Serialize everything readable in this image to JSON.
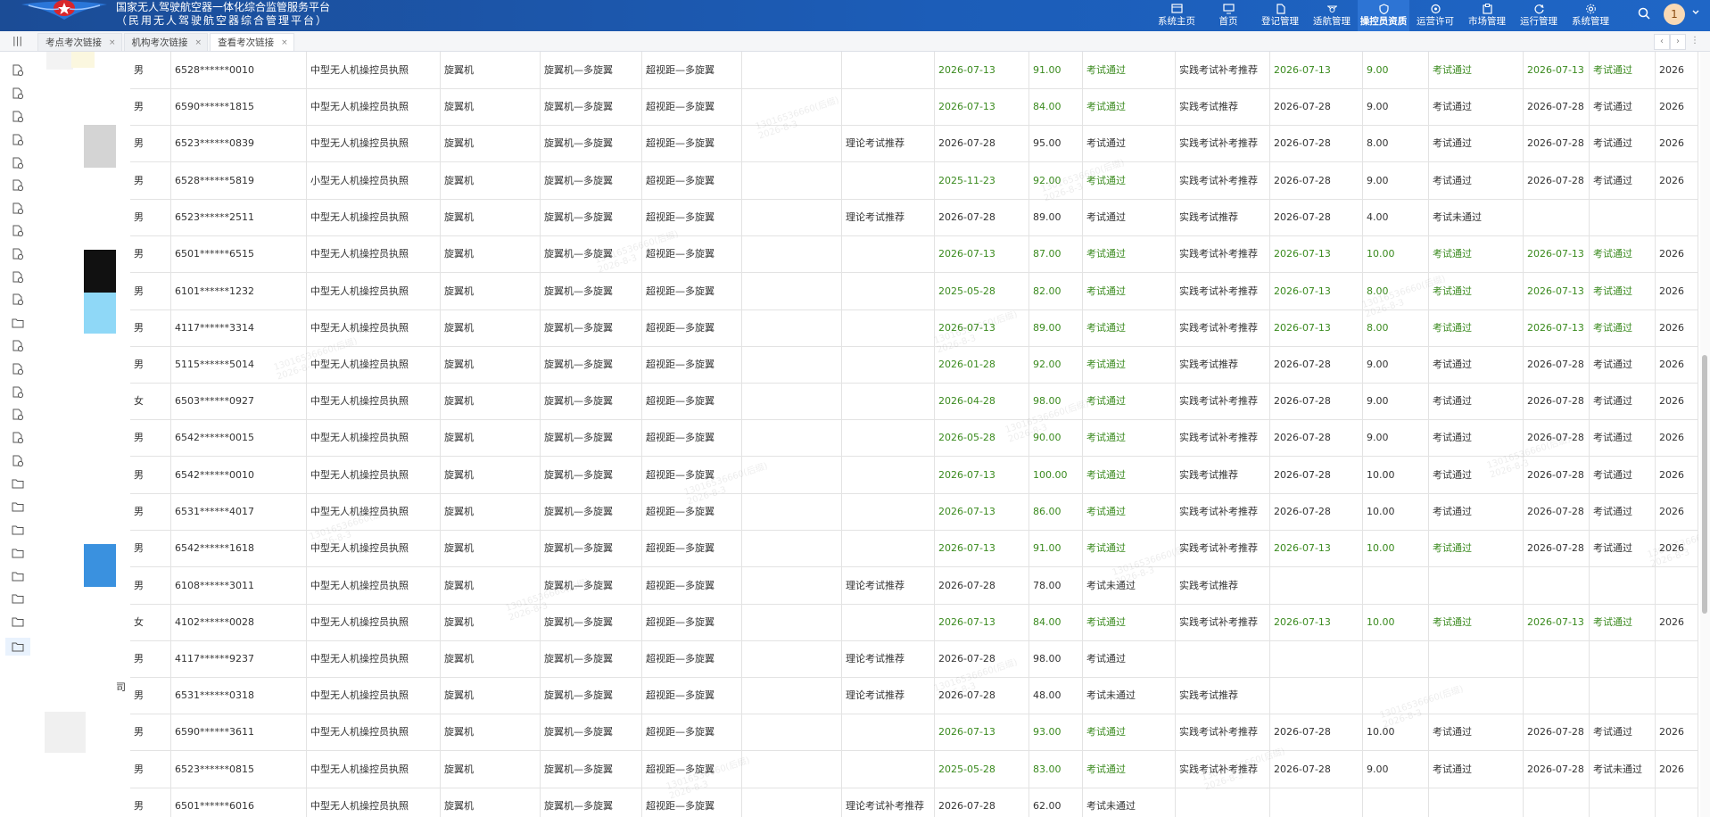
{
  "header": {
    "title_line1": "国家无人驾驶航空器一体化综合监管服务平台",
    "title_line2": "（民用无人驾驶航空器综合管理平台）",
    "nav": [
      {
        "label": "系统主页",
        "icon": "window-icon"
      },
      {
        "label": "首页",
        "icon": "monitor-icon"
      },
      {
        "label": "登记管理",
        "icon": "document-icon"
      },
      {
        "label": "适航管理",
        "icon": "drone-icon"
      },
      {
        "label": "操控员资质",
        "icon": "shield-icon",
        "active": true
      },
      {
        "label": "运营许可",
        "icon": "certificate-icon"
      },
      {
        "label": "市场管理",
        "icon": "clipboard-icon"
      },
      {
        "label": "运行管理",
        "icon": "refresh-icon"
      },
      {
        "label": "系统管理",
        "icon": "settings-icon"
      }
    ],
    "avatar_text": "1",
    "colors": {
      "header_bg": "#1c5db8",
      "active_nav": "#2d74d4",
      "pass_green": "#3a8a1e"
    }
  },
  "tabs": [
    {
      "label": "考点考次链接",
      "close": "×"
    },
    {
      "label": "机构考次链接",
      "close": "×"
    },
    {
      "label": "查看考次链接",
      "close": "×",
      "active": true
    }
  ],
  "tab_nav": {
    "prev": "‹",
    "next": "›",
    "more": "⋮"
  },
  "menu_toggle": "|||",
  "sidebar_fragment": "司",
  "watermark": {
    "line1": "13016536660(后缀)",
    "line2": "2026-8-3"
  },
  "rows": [
    {
      "cols": [
        "男",
        "6528******0010",
        "中型无人机操控员执照",
        "旋翼机",
        "旋翼机—多旋翼",
        "超视距—多旋翼",
        "",
        "",
        "2026-07-13",
        "91.00",
        "考试通过",
        "实践考试补考推荐",
        "2026-07-13",
        "9.00",
        "考试通过",
        "2026-07-13",
        "考试通过",
        "2026"
      ],
      "green": [
        8,
        9,
        10,
        12,
        13,
        14,
        15,
        16
      ]
    },
    {
      "cols": [
        "男",
        "6590******1815",
        "中型无人机操控员执照",
        "旋翼机",
        "旋翼机—多旋翼",
        "超视距—多旋翼",
        "",
        "",
        "2026-07-13",
        "84.00",
        "考试通过",
        "实践考试推荐",
        "2026-07-28",
        "9.00",
        "考试通过",
        "2026-07-28",
        "考试通过",
        "2026"
      ],
      "green": [
        8,
        9,
        10
      ]
    },
    {
      "cols": [
        "男",
        "6523******0839",
        "中型无人机操控员执照",
        "旋翼机",
        "旋翼机—多旋翼",
        "超视距—多旋翼",
        "",
        "理论考试推荐",
        "2026-07-28",
        "95.00",
        "考试通过",
        "实践考试补考推荐",
        "2026-07-28",
        "8.00",
        "考试通过",
        "2026-07-28",
        "考试通过",
        "2026"
      ],
      "green": []
    },
    {
      "cols": [
        "男",
        "6528******5819",
        "小型无人机操控员执照",
        "旋翼机",
        "旋翼机—多旋翼",
        "超视距—多旋翼",
        "",
        "",
        "2025-11-23",
        "92.00",
        "考试通过",
        "实践考试补考推荐",
        "2026-07-28",
        "9.00",
        "考试通过",
        "2026-07-28",
        "考试通过",
        "2026"
      ],
      "green": [
        8,
        9,
        10
      ]
    },
    {
      "cols": [
        "男",
        "6523******2511",
        "中型无人机操控员执照",
        "旋翼机",
        "旋翼机—多旋翼",
        "超视距—多旋翼",
        "",
        "理论考试推荐",
        "2026-07-28",
        "89.00",
        "考试通过",
        "实践考试推荐",
        "2026-07-28",
        "4.00",
        "考试未通过",
        "",
        "",
        ""
      ],
      "green": []
    },
    {
      "cols": [
        "男",
        "6501******6515",
        "中型无人机操控员执照",
        "旋翼机",
        "旋翼机—多旋翼",
        "超视距—多旋翼",
        "",
        "",
        "2026-07-13",
        "87.00",
        "考试通过",
        "实践考试补考推荐",
        "2026-07-13",
        "10.00",
        "考试通过",
        "2026-07-13",
        "考试通过",
        "2026"
      ],
      "green": [
        8,
        9,
        10,
        12,
        13,
        14,
        15,
        16
      ]
    },
    {
      "cols": [
        "男",
        "6101******1232",
        "中型无人机操控员执照",
        "旋翼机",
        "旋翼机—多旋翼",
        "超视距—多旋翼",
        "",
        "",
        "2025-05-28",
        "82.00",
        "考试通过",
        "实践考试补考推荐",
        "2026-07-13",
        "8.00",
        "考试通过",
        "2026-07-13",
        "考试通过",
        "2026"
      ],
      "green": [
        8,
        9,
        10,
        12,
        13,
        14,
        15,
        16
      ]
    },
    {
      "cols": [
        "男",
        "4117******3314",
        "中型无人机操控员执照",
        "旋翼机",
        "旋翼机—多旋翼",
        "超视距—多旋翼",
        "",
        "",
        "2026-07-13",
        "89.00",
        "考试通过",
        "实践考试补考推荐",
        "2026-07-13",
        "8.00",
        "考试通过",
        "2026-07-13",
        "考试通过",
        "2026"
      ],
      "green": [
        8,
        9,
        10,
        12,
        13,
        14,
        15,
        16
      ]
    },
    {
      "cols": [
        "男",
        "5115******5014",
        "中型无人机操控员执照",
        "旋翼机",
        "旋翼机—多旋翼",
        "超视距—多旋翼",
        "",
        "",
        "2026-01-28",
        "92.00",
        "考试通过",
        "实践考试推荐",
        "2026-07-28",
        "9.00",
        "考试通过",
        "2026-07-28",
        "考试通过",
        "2026"
      ],
      "green": [
        8,
        9,
        10
      ]
    },
    {
      "cols": [
        "女",
        "6503******0927",
        "中型无人机操控员执照",
        "旋翼机",
        "旋翼机—多旋翼",
        "超视距—多旋翼",
        "",
        "",
        "2026-04-28",
        "98.00",
        "考试通过",
        "实践考试补考推荐",
        "2026-07-28",
        "9.00",
        "考试通过",
        "2026-07-28",
        "考试通过",
        "2026"
      ],
      "green": [
        8,
        9,
        10
      ]
    },
    {
      "cols": [
        "男",
        "6542******0015",
        "中型无人机操控员执照",
        "旋翼机",
        "旋翼机—多旋翼",
        "超视距—多旋翼",
        "",
        "",
        "2026-05-28",
        "90.00",
        "考试通过",
        "实践考试补考推荐",
        "2026-07-28",
        "9.00",
        "考试通过",
        "2026-07-28",
        "考试通过",
        "2026"
      ],
      "green": [
        8,
        9,
        10
      ]
    },
    {
      "cols": [
        "男",
        "6542******0010",
        "中型无人机操控员执照",
        "旋翼机",
        "旋翼机—多旋翼",
        "超视距—多旋翼",
        "",
        "",
        "2026-07-13",
        "100.00",
        "考试通过",
        "实践考试推荐",
        "2026-07-28",
        "10.00",
        "考试通过",
        "2026-07-28",
        "考试通过",
        "2026"
      ],
      "green": [
        8,
        9,
        10
      ]
    },
    {
      "cols": [
        "男",
        "6531******4017",
        "中型无人机操控员执照",
        "旋翼机",
        "旋翼机—多旋翼",
        "超视距—多旋翼",
        "",
        "",
        "2026-07-13",
        "86.00",
        "考试通过",
        "实践考试补考推荐",
        "2026-07-28",
        "10.00",
        "考试通过",
        "2026-07-28",
        "考试通过",
        "2026"
      ],
      "green": [
        8,
        9,
        10
      ]
    },
    {
      "cols": [
        "男",
        "6542******1618",
        "中型无人机操控员执照",
        "旋翼机",
        "旋翼机—多旋翼",
        "超视距—多旋翼",
        "",
        "",
        "2026-07-13",
        "91.00",
        "考试通过",
        "实践考试补考推荐",
        "2026-07-13",
        "10.00",
        "考试通过",
        "2026-07-28",
        "考试通过",
        "2026"
      ],
      "green": [
        8,
        9,
        10,
        12,
        13,
        14
      ]
    },
    {
      "cols": [
        "男",
        "6108******3011",
        "中型无人机操控员执照",
        "旋翼机",
        "旋翼机—多旋翼",
        "超视距—多旋翼",
        "",
        "理论考试推荐",
        "2026-07-28",
        "78.00",
        "考试未通过",
        "实践考试推荐",
        "",
        "",
        "",
        "",
        "",
        ""
      ],
      "green": []
    },
    {
      "cols": [
        "女",
        "4102******0028",
        "中型无人机操控员执照",
        "旋翼机",
        "旋翼机—多旋翼",
        "超视距—多旋翼",
        "",
        "",
        "2026-07-13",
        "84.00",
        "考试通过",
        "实践考试补考推荐",
        "2026-07-13",
        "10.00",
        "考试通过",
        "2026-07-13",
        "考试通过",
        "2026"
      ],
      "green": [
        8,
        9,
        10,
        12,
        13,
        14,
        15,
        16
      ]
    },
    {
      "cols": [
        "男",
        "4117******9237",
        "中型无人机操控员执照",
        "旋翼机",
        "旋翼机—多旋翼",
        "超视距—多旋翼",
        "",
        "理论考试推荐",
        "2026-07-28",
        "98.00",
        "考试通过",
        "",
        "",
        "",
        "",
        "",
        "",
        ""
      ],
      "green": []
    },
    {
      "cols": [
        "男",
        "6531******0318",
        "中型无人机操控员执照",
        "旋翼机",
        "旋翼机—多旋翼",
        "超视距—多旋翼",
        "",
        "理论考试推荐",
        "2026-07-28",
        "48.00",
        "考试未通过",
        "实践考试推荐",
        "",
        "",
        "",
        "",
        "",
        ""
      ],
      "green": []
    },
    {
      "cols": [
        "男",
        "6590******3611",
        "中型无人机操控员执照",
        "旋翼机",
        "旋翼机—多旋翼",
        "超视距—多旋翼",
        "",
        "",
        "2026-07-13",
        "93.00",
        "考试通过",
        "实践考试补考推荐",
        "2026-07-28",
        "10.00",
        "考试通过",
        "2026-07-28",
        "考试通过",
        "2026"
      ],
      "green": [
        8,
        9,
        10
      ]
    },
    {
      "cols": [
        "男",
        "6523******0815",
        "中型无人机操控员执照",
        "旋翼机",
        "旋翼机—多旋翼",
        "超视距—多旋翼",
        "",
        "",
        "2025-05-28",
        "83.00",
        "考试通过",
        "实践考试补考推荐",
        "2026-07-28",
        "9.00",
        "考试通过",
        "2026-07-28",
        "考试未通过",
        "2026"
      ],
      "green": [
        8,
        9,
        10
      ]
    },
    {
      "cols": [
        "男",
        "6501******6016",
        "中型无人机操控员执照",
        "旋翼机",
        "旋翼机—多旋翼",
        "超视距—多旋翼",
        "",
        "理论考试补考推荐",
        "2026-07-28",
        "62.00",
        "考试未通过",
        "",
        "",
        "",
        "",
        "",
        "",
        ""
      ],
      "green": []
    }
  ]
}
